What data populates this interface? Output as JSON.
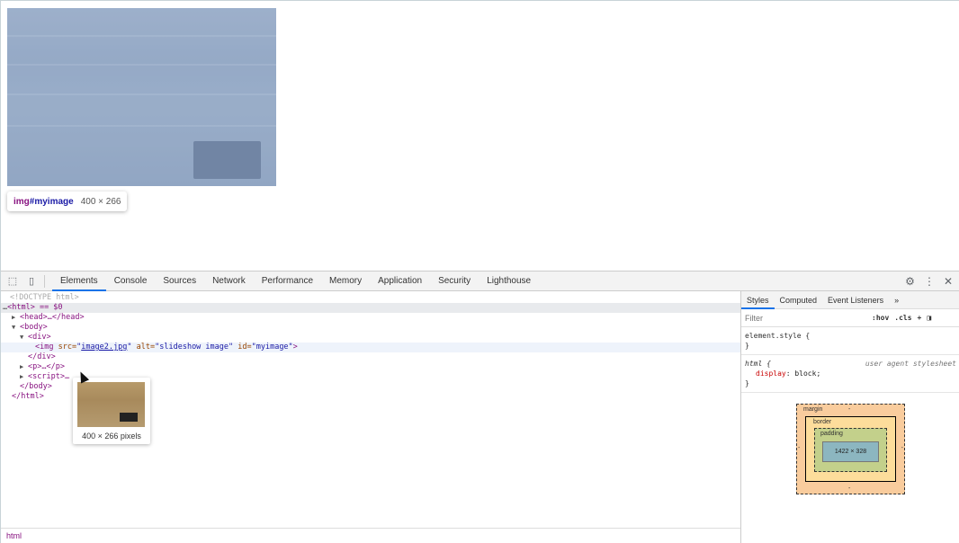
{
  "tooltip": {
    "tag": "img",
    "id": "#myimage",
    "size": "400 × 266"
  },
  "devtools": {
    "tabs": [
      "Elements",
      "Console",
      "Sources",
      "Network",
      "Performance",
      "Memory",
      "Application",
      "Security",
      "Lighthouse"
    ],
    "active_tab": "Elements"
  },
  "dom": {
    "doctype": "<!DOCTYPE html>",
    "html_line": "<html> == $0",
    "head_line": "<head>…</head>",
    "body_line": "<body>",
    "div_line": "<div>",
    "img_tag": "<img ",
    "img_src_attr": "src=",
    "img_src_val": "image2.jpg",
    "img_alt_attr": "alt=",
    "img_alt_val": "\"slideshow image\"",
    "img_id_attr": "id=",
    "img_id_val": "\"myimage\"",
    "img_end": ">",
    "div_close": "</div>",
    "p_line": "<p>…</p>",
    "script_line": "<script>…",
    "body_close": "</body>",
    "html_close": "</html>"
  },
  "preview": {
    "caption": "400 × 266 pixels"
  },
  "breadcrumb": "html",
  "styles": {
    "tabs": [
      "Styles",
      "Computed",
      "Event Listeners"
    ],
    "filter_placeholder": "Filter",
    "hov": ":hov",
    "cls": ".cls",
    "element_style": "element.style {",
    "element_close": "}",
    "rule_selector": "html {",
    "rule_origin": "user agent stylesheet",
    "rule_prop": "display",
    "rule_val": "block;",
    "rule_close": "}",
    "boxmodel": {
      "margin": "margin",
      "border": "border",
      "padding": "padding",
      "content": "1422 × 328",
      "dash": "-"
    }
  }
}
